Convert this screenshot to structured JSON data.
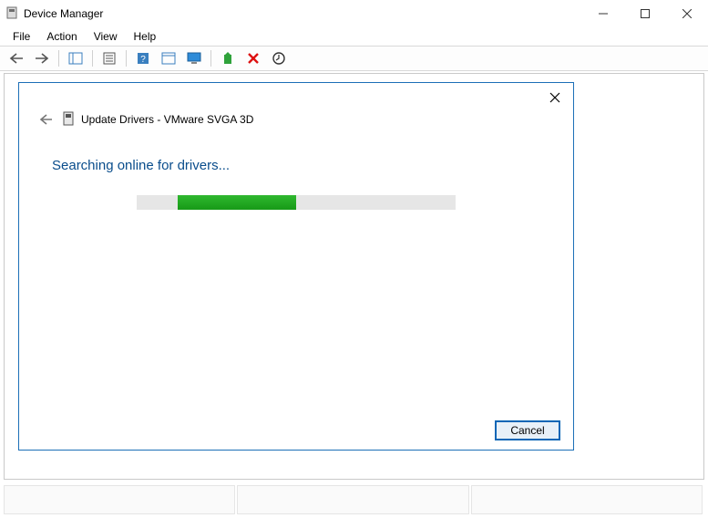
{
  "window": {
    "title": "Device Manager"
  },
  "menu": {
    "file": "File",
    "action": "Action",
    "view": "View",
    "help": "Help"
  },
  "toolbar_icons": {
    "back": "back-arrow-icon",
    "forward": "forward-arrow-icon",
    "show_hide": "show-hide-tree-icon",
    "properties": "properties-icon",
    "help": "help-icon",
    "action_list": "action-list-icon",
    "monitor": "monitor-icon",
    "add_legacy": "add-legacy-hardware-icon",
    "uninstall": "uninstall-icon",
    "scan": "scan-hardware-changes-icon"
  },
  "dialog": {
    "title": "Update Drivers - VMware SVGA 3D",
    "status": "Searching online for drivers...",
    "cancel": "Cancel"
  }
}
